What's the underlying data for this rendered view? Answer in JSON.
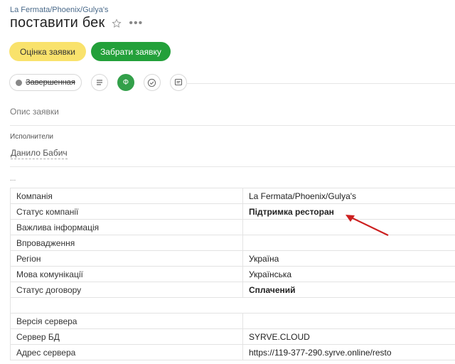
{
  "breadcrumb": "La Fermata/Phoenix/Gulya's",
  "title": "поставити бек",
  "buttons": {
    "rate": "Оцінка заявки",
    "take": "Забрати заявку"
  },
  "status": {
    "label": "Завершенная",
    "green_badge": "Ф"
  },
  "description_label": "Опис заявки",
  "executors": {
    "label": "Исполнители",
    "name": "Данило Бабич"
  },
  "ellipsis": "...",
  "table": {
    "rows": [
      {
        "key": "Компанія",
        "value": "La Fermata/Phoenix/Gulya's"
      },
      {
        "key": "Статус компанії",
        "value": "Підтримка ресторан"
      },
      {
        "key": "Важлива інформація",
        "value": ""
      },
      {
        "key": "Впровадження",
        "value": ""
      },
      {
        "key": "Регіон",
        "value": "Україна"
      },
      {
        "key": "Мова комунікації",
        "value": "Українська"
      },
      {
        "key": "Статус договору",
        "value": "Сплачений"
      },
      {
        "key": "",
        "value": ""
      },
      {
        "key": "Версія сервера",
        "value": ""
      },
      {
        "key": "Сервер БД",
        "value": "SYRVE.CLOUD"
      },
      {
        "key": "Адрес сервера",
        "value": "https://119-377-290.syrve.online/resto"
      }
    ]
  },
  "colors": {
    "accent_green": "#23a03a",
    "accent_yellow": "#f9e26c",
    "warning_red": "#d9453a",
    "link_blue": "#2a6fb5",
    "arrow_red": "#cc1f1f"
  },
  "icons": {
    "star": "star-icon",
    "more": "more-icon",
    "list": "list-icon",
    "check": "check-circle-icon",
    "comment": "comment-icon",
    "arrow": "annotation-arrow-icon"
  }
}
